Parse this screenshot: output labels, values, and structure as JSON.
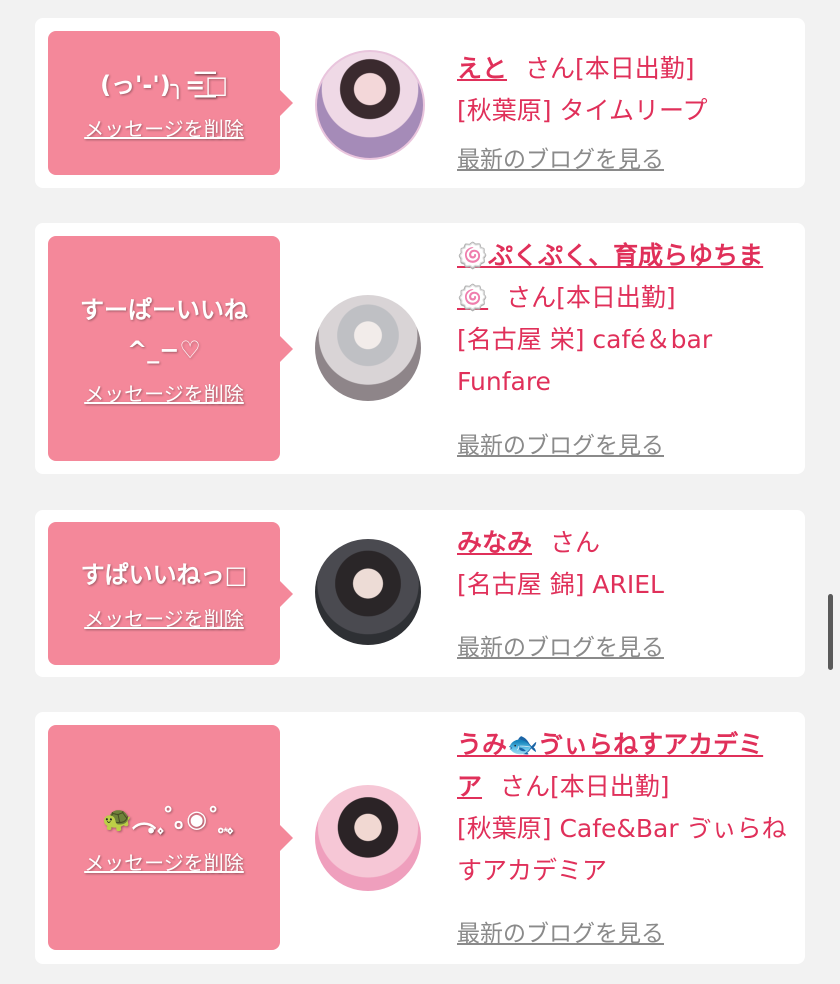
{
  "delete_label": "メッセージを削除",
  "blog_label": "最新のブログを見る",
  "san_label": "さん",
  "cards": [
    {
      "message": "(っ'-')╮=͟͟͞͞□",
      "name": "えと",
      "status": "[本日出勤]",
      "shop": "[秋葉原] タイムリープ"
    },
    {
      "message": "すーぱーいいね ^_−♡",
      "name": "🍥ぷくぷく、育成らゆちま🍥",
      "status": "[本日出勤]",
      "shop": "[名古屋 栄] café＆bar Funfare"
    },
    {
      "message": "すぱいいねっ□",
      "name": "みなみ",
      "status": "",
      "shop": "[名古屋 錦] ARIEL"
    },
    {
      "message": "🐢︵ ͙۪۪̥˚｡◉˚ ͙۪۪̥",
      "name": "うみ🐟ゔぃらねすアカデミア",
      "status": "[本日出勤]",
      "shop": "[秋葉原] Cafe&Bar ゔぃらねすアカデミア"
    }
  ],
  "colors": {
    "bubble": "#f4889a",
    "accent": "#e0305a",
    "link_gray": "#8a8a8a",
    "background": "#f2f2f2"
  }
}
